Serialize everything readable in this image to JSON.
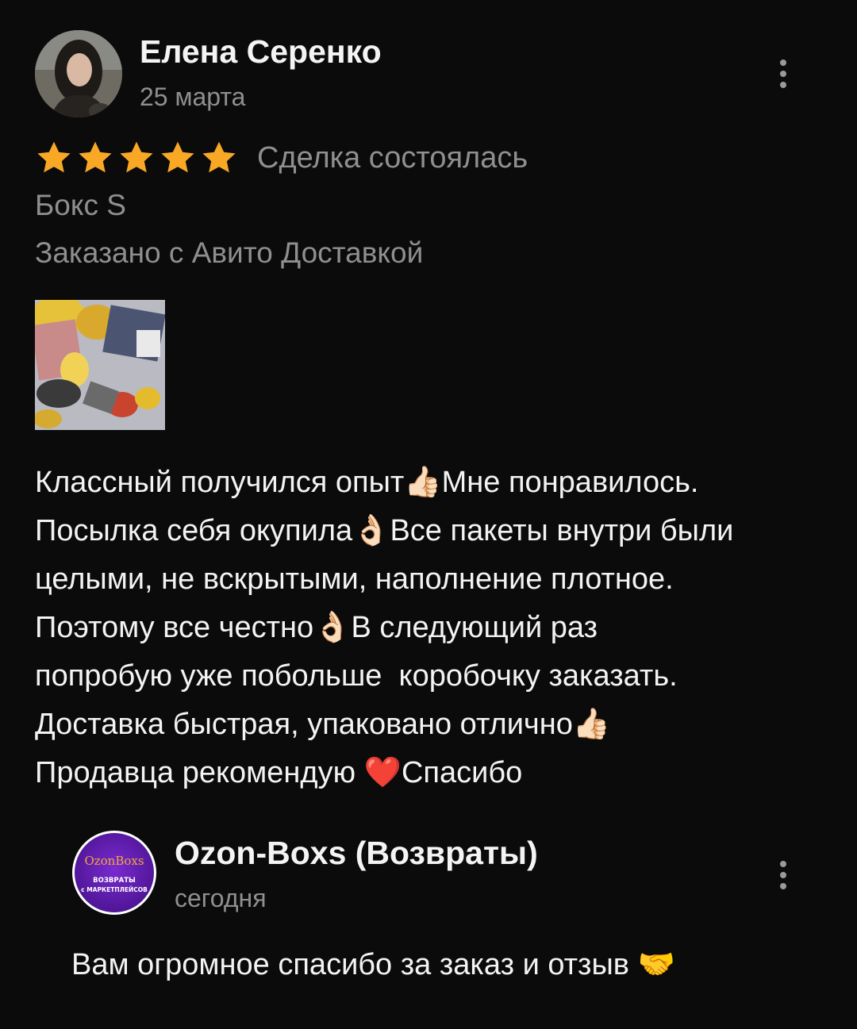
{
  "review": {
    "author_name": "Елена Серенко",
    "date": "25 марта",
    "rating": 5,
    "rating_max": 5,
    "star_color": "#f9a825",
    "deal_status": "Сделка состоялась",
    "product": "Бокс S",
    "delivery_note": "Заказано с Авито Доставкой",
    "text_lines": [
      "Классный получился опыт👍🏻Мне понравилось.",
      "Посылка себя окупила👌🏻Все пакеты внутри были",
      "целыми, не вскрытыми, наполнение плотное.",
      "Поэтому все честно👌🏻В следующий раз",
      "попробую уже побольше  коробочку заказать.",
      "Доставка быстрая, упаковано отлично👍🏻",
      "Продавца рекомендую ❤️Спасибо"
    ]
  },
  "reply": {
    "seller_name": "Ozon-Boxs (Возвраты)",
    "date": "сегодня",
    "logo_title": "OzonBoxs",
    "logo_line1": "ВОЗВРАТЫ",
    "logo_line2": "с МАРКЕТПЛЕЙСОВ",
    "text": "Вам огромное спасибо за заказ и отзыв 🤝"
  },
  "icons": {
    "more": "more-vertical-icon",
    "star": "star-icon"
  }
}
